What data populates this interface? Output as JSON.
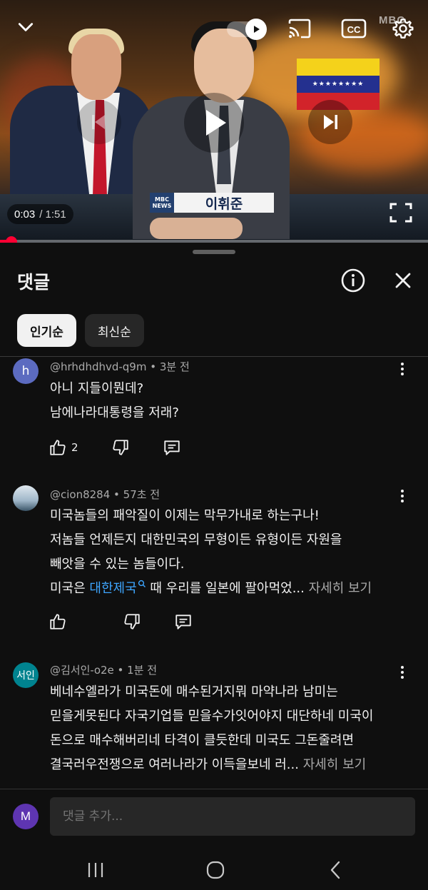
{
  "video": {
    "current_time": "0:03",
    "duration": "/ 1:51",
    "progress_fraction": 0.027,
    "nameplate_name": "이휘준",
    "nameplate_logo": "MBC NEWS",
    "watermark": "MBC",
    "controls": [
      "collapse-icon",
      "autoplay-toggle",
      "cast-icon",
      "captions-icon",
      "settings-icon",
      "previous-icon",
      "play-icon",
      "next-icon",
      "fullscreen-icon"
    ],
    "accent_color": "#ff0033"
  },
  "sheet": {
    "title": "댓글",
    "chips": [
      {
        "label": "인기순",
        "active": true
      },
      {
        "label": "최신순",
        "active": false
      }
    ]
  },
  "comments": [
    {
      "avatar_letter": "h",
      "avatar_color": "#5c6bc0",
      "meta": "@hrhdhdhvd-q9m • 3분 전",
      "lines": [
        "아니 지들이뭔데?",
        "남에나라대통령을 저래?"
      ],
      "likes": "2"
    },
    {
      "avatar_letter": "",
      "avatar_color": "#9fb6c8",
      "meta": "@cion8284 • 57초 전",
      "lines": [
        "미국놈들의 패악질이 이제는 막무가내로 하는구나!",
        "저놈들 언제든지 대한민국의 무형이든 유형이든 자원을",
        "빼앗을 수 있는 놈들이다."
      ],
      "last_line_prefix": "미국은 ",
      "last_line_link": "대한제국",
      "last_line_suffix": " 때 우리를 일본에 팔아먹었...",
      "more_label": " 자세히 보기",
      "likes": ""
    },
    {
      "avatar_letter": "서인",
      "avatar_color": "#00838f",
      "meta": "@김서인-o2e • 1분 전",
      "lines": [
        "베네수엘라가 미국돈에 매수된거지뭐 마약나라 남미는",
        "믿을게못된다 자국기업들 믿을수가잇어야지 대단하네 미국이",
        "돈으로 매수해버리네 타격이 클듯한데 미국도 그돈줄려면"
      ],
      "last_line_prefix": "결국러우전쟁으로 여러나라가 이득을보네 러...",
      "more_label": " 자세히 보기"
    }
  ],
  "input": {
    "avatar_letter": "M",
    "placeholder": "댓글 추가..."
  }
}
